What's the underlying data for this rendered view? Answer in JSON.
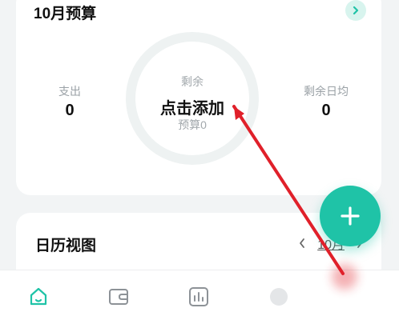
{
  "budget": {
    "title": "10月预算",
    "center_label": "剩余",
    "center_action": "点击添加",
    "center_budget": "预算0",
    "expense_label": "支出",
    "expense_value": "0",
    "daily_label": "剩余日均",
    "daily_value": "0"
  },
  "calendar": {
    "title": "日历视图",
    "month": "10月"
  },
  "colors": {
    "accent": "#1fc3a7",
    "annotation": "#e0202a"
  },
  "icons": {
    "nav": [
      "home-icon",
      "wallet-icon",
      "chart-icon",
      "profile-icon"
    ],
    "fab": "plus-icon",
    "budget_link": "chevron-right-icon"
  }
}
